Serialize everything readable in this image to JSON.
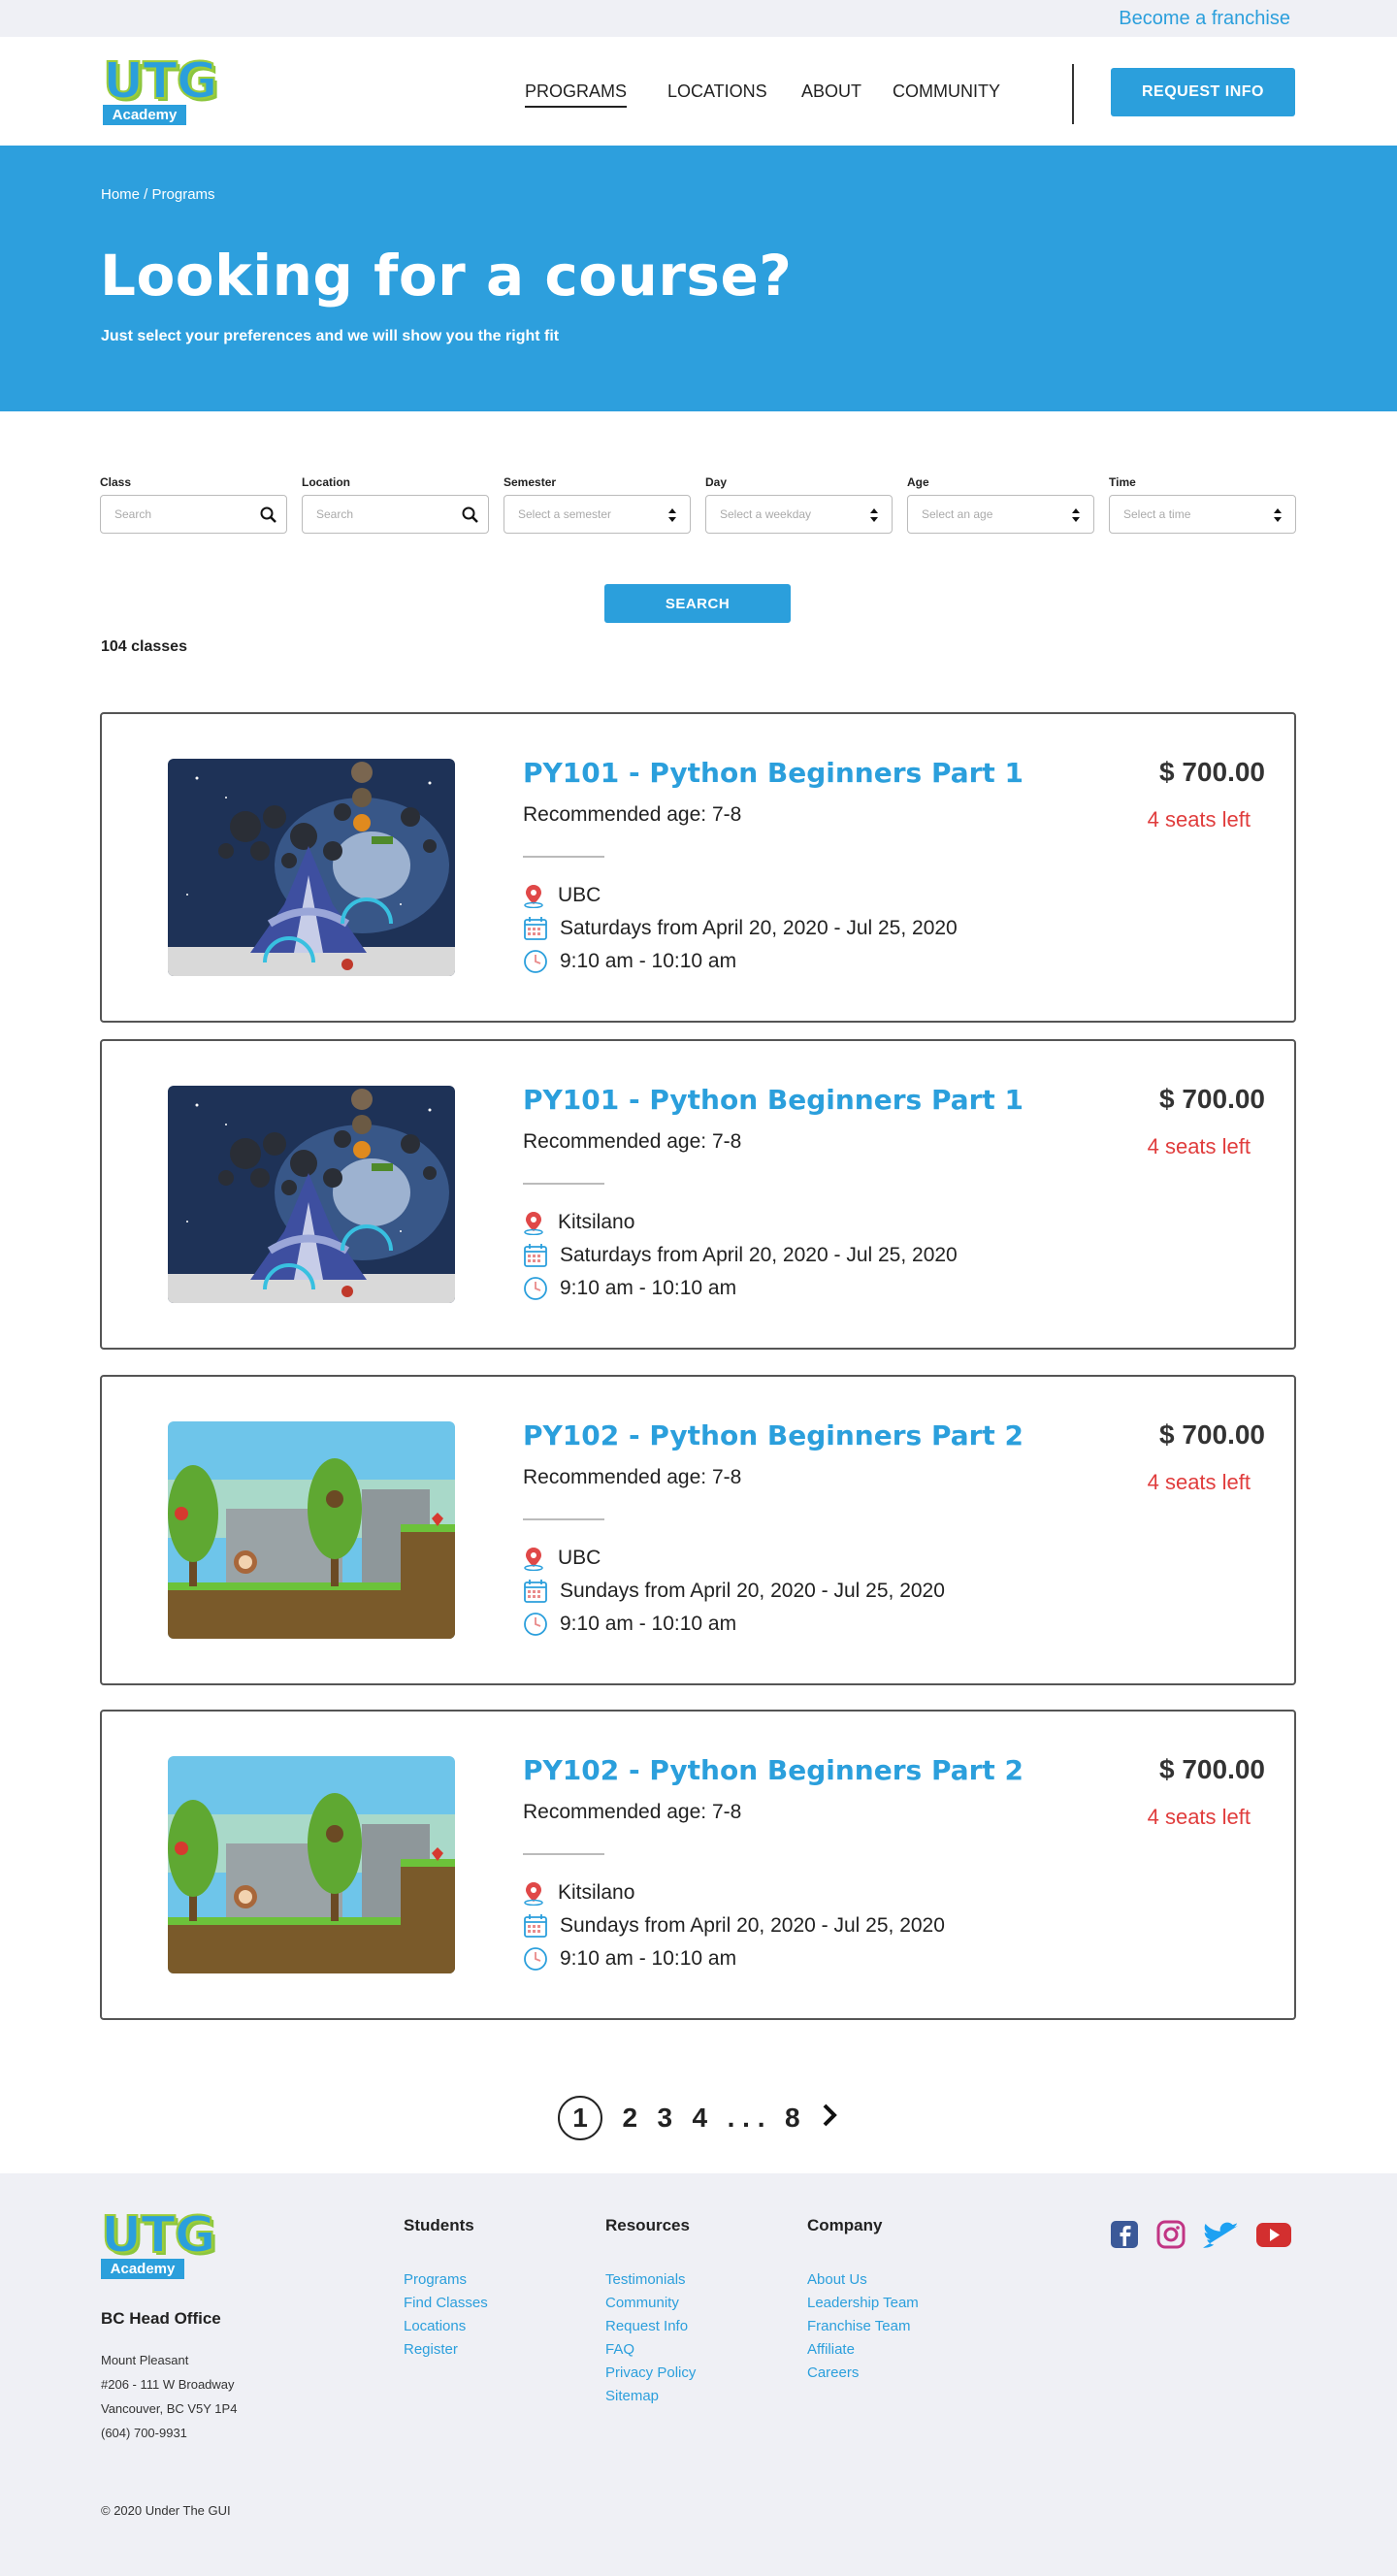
{
  "top_bar": {
    "franchise_link": "Become a franchise"
  },
  "brand": {
    "logo_letters": "UTG",
    "logo_sub": "Academy"
  },
  "nav": {
    "items": [
      {
        "label": "PROGRAMS",
        "active": true
      },
      {
        "label": "LOCATIONS",
        "active": false
      },
      {
        "label": "ABOUT",
        "active": false
      },
      {
        "label": "COMMUNITY",
        "active": false
      }
    ],
    "cta": "REQUEST INFO"
  },
  "hero": {
    "breadcrumb": "Home / Programs",
    "title": "Looking for a course?",
    "subtitle": "Just select your preferences and we will show you the right fit"
  },
  "filters": [
    {
      "label": "Class",
      "placeholder": "Search",
      "kind": "search"
    },
    {
      "label": "Location",
      "placeholder": "Search",
      "kind": "search"
    },
    {
      "label": "Semester",
      "placeholder": "Select a semester",
      "kind": "select"
    },
    {
      "label": "Day",
      "placeholder": "Select a weekday",
      "kind": "select"
    },
    {
      "label": "Age",
      "placeholder": "Select an age",
      "kind": "select"
    },
    {
      "label": "Time",
      "placeholder": "Select a time",
      "kind": "select"
    }
  ],
  "search_button": "SEARCH",
  "results_count": "104 classes",
  "classes": [
    {
      "title": "PY101 - Python Beginners Part 1",
      "age": "Recommended age: 7-8",
      "location": "UBC",
      "schedule": "Saturdays from April 20, 2020 - Jul 25, 2020",
      "time": "9:10 am - 10:10 am",
      "price": "$ 700.00",
      "seats": "4 seats left",
      "image": "space-shooter"
    },
    {
      "title": "PY101 - Python Beginners Part 1",
      "age": "Recommended age: 7-8",
      "location": "Kitsilano",
      "schedule": "Saturdays from April 20, 2020 - Jul 25, 2020",
      "time": "9:10 am - 10:10 am",
      "price": "$ 700.00",
      "seats": "4 seats left",
      "image": "space-shooter"
    },
    {
      "title": "PY102 - Python Beginners Part 2",
      "age": "Recommended age: 7-8",
      "location": "UBC",
      "schedule": "Sundays from April 20, 2020 - Jul 25, 2020",
      "time": "9:10 am - 10:10 am",
      "price": "$ 700.00",
      "seats": "4 seats left",
      "image": "pixel-platformer"
    },
    {
      "title": "PY102 - Python Beginners Part 2",
      "age": "Recommended age: 7-8",
      "location": "Kitsilano",
      "schedule": "Sundays from April 20, 2020 - Jul 25, 2020",
      "time": "9:10 am - 10:10 am",
      "price": "$ 700.00",
      "seats": "4 seats left",
      "image": "pixel-platformer"
    }
  ],
  "pagination": {
    "pages": [
      "1",
      "2",
      "3",
      "4",
      ". . .",
      "8"
    ],
    "current": "1",
    "next_icon": "chevron-right-icon"
  },
  "footer": {
    "office_title": "BC Head Office",
    "address": [
      "Mount Pleasant",
      "#206 - 111 W Broadway",
      "Vancouver, BC V5Y 1P4",
      "(604) 700-9931"
    ],
    "columns": [
      {
        "title": "Students",
        "links": [
          "Programs",
          "Find Classes",
          "Locations",
          "Register"
        ]
      },
      {
        "title": "Resources",
        "links": [
          "Testimonials",
          "Community",
          "Request Info",
          "FAQ",
          "Privacy Policy",
          "Sitemap"
        ]
      },
      {
        "title": "Company",
        "links": [
          "About Us",
          "Leadership Team",
          "Franchise Team",
          "Affiliate",
          "Careers"
        ]
      }
    ],
    "social": [
      "facebook-icon",
      "instagram-icon",
      "twitter-icon",
      "youtube-icon"
    ],
    "copyright": "© 2020 Under The GUI"
  },
  "colors": {
    "brand_blue": "#2b9fdc",
    "hero_blue": "#2d9fdd",
    "seats_red": "#e03c3c",
    "footer_bg": "#eff0f5"
  }
}
